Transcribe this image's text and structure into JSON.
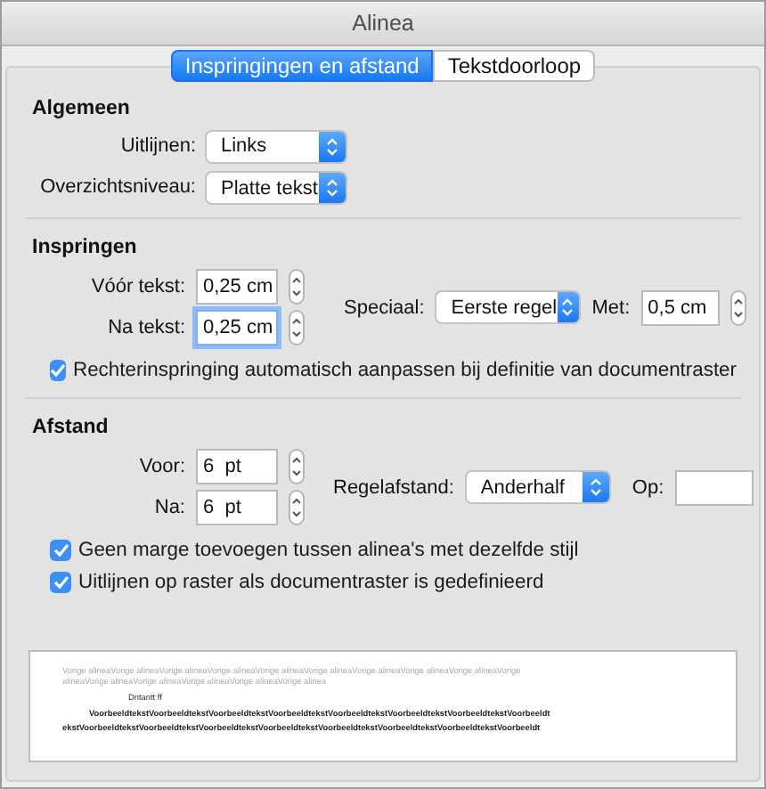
{
  "window": {
    "title": "Alinea"
  },
  "tabs": [
    {
      "label": "Inspringingen en afstand",
      "selected": true
    },
    {
      "label": "Tekstdoorloop",
      "selected": false
    }
  ],
  "general": {
    "heading": "Algemeen",
    "alignment": {
      "label": "Uitlijnen:",
      "value": "Links"
    },
    "outline_level": {
      "label": "Overzichtsniveau:",
      "value": "Platte tekst"
    }
  },
  "indentation": {
    "heading": "Inspringen",
    "before": {
      "label": "Vóór tekst:",
      "value": "0,25 cm",
      "focused": false
    },
    "after": {
      "label": "Na tekst:",
      "value": "0,25 cm",
      "focused": true
    },
    "special": {
      "label": "Speciaal:",
      "value": "Eerste regel"
    },
    "by": {
      "label": "Met:",
      "value": "0,5 cm",
      "focused": false
    },
    "options": [
      {
        "label": "Rechterinspringing automatisch aanpassen bij definitie van documentraster",
        "checked": true
      }
    ]
  },
  "spacing": {
    "heading": "Afstand",
    "before": {
      "label": "Voor:",
      "value": "6  pt",
      "focused": false
    },
    "after": {
      "label": "Na:",
      "value": "6  pt",
      "focused": false
    },
    "line_spacing": {
      "label": "Regelafstand:",
      "value": "Anderhalf"
    },
    "at": {
      "label": "Op:",
      "focused": false
    },
    "options": [
      {
        "label": "Geen marge toevoegen tussen alinea's met dezelfde stijl",
        "checked": true
      },
      {
        "label": "Uitlijnen op raster als documentraster is gedefinieerd",
        "checked": true
      }
    ]
  },
  "preview": {
    "lines": [
      {
        "kind": "previous",
        "text": "Vorige alineaVorige alineaVorige alineaVorige alineaVorige alineaVorige alineaVorige alineaVorige alineaVorige alineaVorige"
      },
      {
        "kind": "previous",
        "text": "alineaVorige alineaVorige alineaVorige alineaVorige alineaVorige alinea"
      },
      {
        "kind": "label",
        "text": "Dntantt ff"
      },
      {
        "kind": "sample_first",
        "text": "VoorbeeldtekstVoorbeeldtekstVoorbeeldtekstVoorbeeldtekstVoorbeeldtekstVoorbeeldtekstVoorbeeldtekstVoorbeeldt"
      },
      {
        "kind": "sample",
        "text": "ekstVoorbeeldtekstVoorbeeldtekstVoorbeeldtekstVoorbeeldtekstVoorbeeldtekstVoorbeeldtekstVoorbeeldtekstVoorbeeldt"
      }
    ]
  }
}
